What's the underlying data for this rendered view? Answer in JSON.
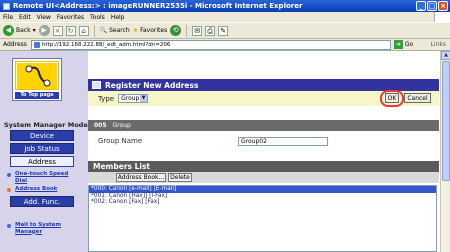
{
  "window": {
    "title": "Remote UI<Address:> : imageRUNNER2535i - Microsoft Internet Explorer"
  },
  "menu": [
    "File",
    "Edit",
    "View",
    "Favorites",
    "Tools",
    "Help"
  ],
  "toolbar": {
    "back_label": "Back",
    "search_label": "Search",
    "favorites_label": "Favorites"
  },
  "address": {
    "label": "Address",
    "url": "http://192.168.222.88/_edt_adm.html?dn=206",
    "go_label": "Go",
    "links_label": "Links"
  },
  "sidebar": {
    "top_page": "To Top page",
    "mode_label": "System Manager Mode",
    "buttons": [
      "Device",
      "Job Status",
      "Address"
    ],
    "links": [
      "One-touch Speed Dial",
      "Address Book"
    ],
    "add_func": "Add. Func.",
    "mail_link": "Mail to System Manager"
  },
  "register": {
    "title": "Register New Address",
    "type_label": "Type",
    "type_value": "Group",
    "ok_label": "OK",
    "cancel_label": "Cancel"
  },
  "entry": {
    "number": "005",
    "type": "Group",
    "name_label": "Group Name",
    "name_value": "Group02"
  },
  "members": {
    "title": "Members List",
    "address_book_btn": "Address Book...",
    "delete_btn": "Delete",
    "items": [
      "*000: Canon [e-mail] [E-mail]",
      "*001: Canon [Hax]] [I-Fax]",
      "*002: Canon [Fax] [Fax]"
    ]
  }
}
